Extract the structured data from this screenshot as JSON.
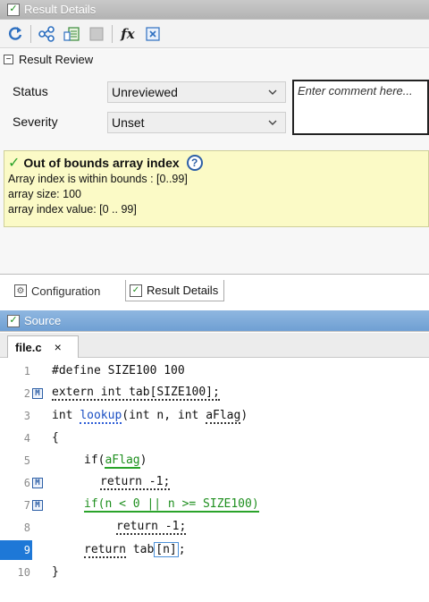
{
  "result_details_panel": {
    "title": "Result Details",
    "toolbar": {
      "fx_label": "fx"
    },
    "review": {
      "section_title": "Result Review",
      "status_label": "Status",
      "status_value": "Unreviewed",
      "severity_label": "Severity",
      "severity_value": "Unset",
      "comment_placeholder": "Enter comment here..."
    },
    "result": {
      "title": "Out of bounds array index",
      "lines": [
        "Array index is within bounds : [0..99]",
        "array size: 100",
        "array index value: [0 .. 99]"
      ]
    }
  },
  "bottom_tabs": [
    {
      "label": "Configuration"
    },
    {
      "label": "Result Details"
    }
  ],
  "source_panel": {
    "title": "Source",
    "file_tab": "file.c",
    "close_symbol": "×",
    "lines": [
      {
        "num": "1",
        "text": "#define SIZE100 100"
      },
      {
        "num": "2",
        "text": "extern int tab[SIZE100];",
        "badge": "M"
      },
      {
        "num": "3",
        "text_a": "int ",
        "text_b": "lookup",
        "text_c": "(int n, int ",
        "text_d": "aFlag",
        "text_e": ")"
      },
      {
        "num": "4",
        "text": "{"
      },
      {
        "num": "5",
        "text_a": "if(",
        "text_b": "aFlag",
        "text_c": ")"
      },
      {
        "num": "6",
        "text": "return -1;",
        "badge": "M"
      },
      {
        "num": "7",
        "text": "if(n < 0 || n >= SIZE100)",
        "badge": "M"
      },
      {
        "num": "8",
        "text": "return -1;"
      },
      {
        "num": "9",
        "text_a": "return",
        "text_b": " tab",
        "text_c": "[n]",
        "text_d": ";"
      },
      {
        "num": "10",
        "text": "}"
      }
    ]
  },
  "colors": {
    "result_box_bg": "#fbfac6",
    "source_title_bar": "#7aa7d8",
    "selected_line": "#1e78d7",
    "check_green": "#2aa32a"
  }
}
